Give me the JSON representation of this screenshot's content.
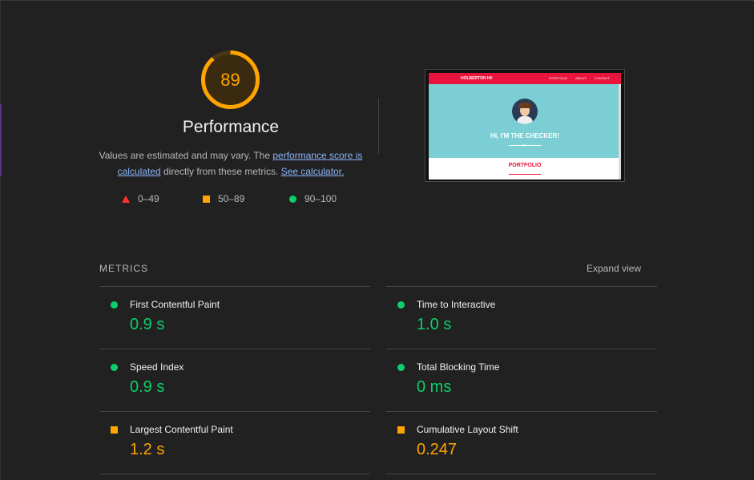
{
  "score": {
    "value": "89",
    "fraction": 0.89,
    "color": "#ffa400"
  },
  "title": "Performance",
  "description": {
    "prefix": "Values are estimated and may vary. The ",
    "link1": "performance score is calculated",
    "middle": " directly from these metrics. ",
    "link2": "See calculator."
  },
  "legend": [
    {
      "range": "0–49",
      "shape": "triangle",
      "color": "#ff3333"
    },
    {
      "range": "50–89",
      "shape": "square",
      "color": "#ffa400"
    },
    {
      "range": "90–100",
      "shape": "circle",
      "color": "#0cce6b"
    }
  ],
  "thumbnail": {
    "brand": "HOLBERTON HI!",
    "nav": [
      "PORTFOLIO",
      "ABOUT",
      "CONTACT"
    ],
    "heading": "HI, I'M THE CHECKER!",
    "section": "PORTFOLIO"
  },
  "metrics_label": "METRICS",
  "expand_label": "Expand view",
  "metrics": [
    {
      "name": "First Contentful Paint",
      "value": "0.9 s",
      "status": "good"
    },
    {
      "name": "Time to Interactive",
      "value": "1.0 s",
      "status": "good"
    },
    {
      "name": "Speed Index",
      "value": "0.9 s",
      "status": "good"
    },
    {
      "name": "Total Blocking Time",
      "value": "0 ms",
      "status": "good"
    },
    {
      "name": "Largest Contentful Paint",
      "value": "1.2 s",
      "status": "average"
    },
    {
      "name": "Cumulative Layout Shift",
      "value": "0.247",
      "status": "average"
    }
  ]
}
